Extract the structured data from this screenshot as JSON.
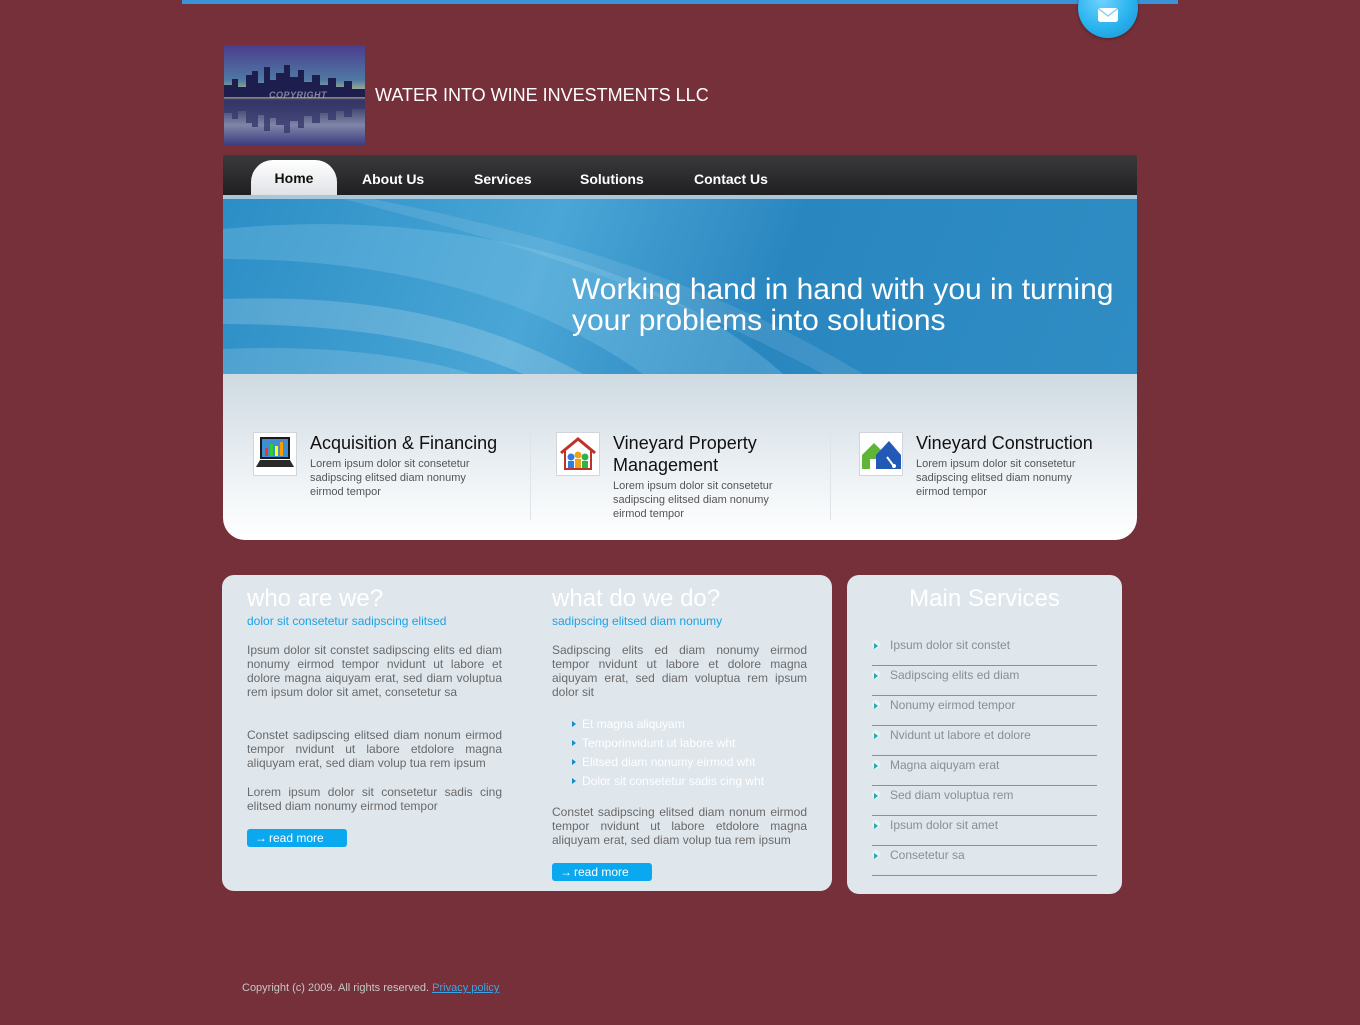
{
  "header": {
    "company_name": "WATER INTO WINE INVESTMENTS LLC",
    "logo_watermark": "COPYRIGHT"
  },
  "nav": {
    "items": [
      {
        "label": "Home",
        "active": true
      },
      {
        "label": "About Us"
      },
      {
        "label": "Services"
      },
      {
        "label": "Solutions"
      },
      {
        "label": "Contact Us"
      }
    ]
  },
  "banner": {
    "headline": "Working hand in hand with you in turning your problems into solutions"
  },
  "features": [
    {
      "title": "Acquisition & Financing",
      "text": "Lorem ipsum dolor sit consetetur sadipscing elitsed diam nonumy eirmod tempor",
      "icon": "laptop-chart-icon"
    },
    {
      "title": "Vineyard Property Management",
      "text": "Lorem ipsum dolor sit consetetur sadipscing elitsed diam nonumy eirmod tempor",
      "icon": "house-people-icon"
    },
    {
      "title": "Vineyard Construction",
      "text": "Lorem ipsum dolor sit consetetur sadipscing elitsed diam nonumy eirmod tempor",
      "icon": "house-tools-icon"
    }
  ],
  "who": {
    "heading": "who are we?",
    "subheading": "dolor sit consetetur sadipscing elitsed",
    "paragraphs": [
      "Ipsum dolor sit constet sadipscing elits ed diam nonumy eirmod tempor nvidunt ut labore et dolore magna aiquyam erat, sed diam voluptua rem ipsum dolor sit amet, consetetur sa",
      "Constet sadipscing elitsed diam nonum eirmod tempor nvidunt ut labore etdolore magna aliquyam erat, sed diam volup tua rem ipsum",
      "Lorem ipsum dolor sit consetetur sadis cing elitsed diam nonumy eirmod tempor"
    ],
    "read_more": "read more"
  },
  "what": {
    "heading": "what do we do?",
    "subheading": "sadipscing elitsed diam nonumy",
    "paragraph1": "Sadipscing elits ed diam nonumy eirmod tempor nvidunt ut labore et dolore magna aiquyam erat, sed diam voluptua rem ipsum dolor sit",
    "bullets": [
      "Et magna aliquyam",
      "Temporinvidunt ut labore wht",
      "Elitsed diam nonumy eirmod wht",
      "Dolor sit consetetur sadis cing wht"
    ],
    "paragraph2": "Constet sadipscing elitsed diam nonum eirmod tempor nvidunt ut labore etdolore magna aliquyam erat, sed diam volup tua rem ipsum",
    "read_more": "read more"
  },
  "services": {
    "heading": "Main Services",
    "items": [
      "Ipsum dolor sit constet",
      "Sadipscing elits ed diam",
      "Nonumy eirmod tempor",
      "Nvidunt ut labore et dolore",
      "Magna aiquyam erat",
      "Sed diam voluptua rem",
      "Ipsum dolor sit amet",
      "Consetetur sa"
    ]
  },
  "footer": {
    "copyright": "Copyright (c) 2009. All rights reserved.",
    "privacy_link": "Privacy policy"
  },
  "colors": {
    "page_background": "#76303a",
    "accent_blue": "#0aa8ef",
    "panel_background": "#dfe6ec"
  }
}
